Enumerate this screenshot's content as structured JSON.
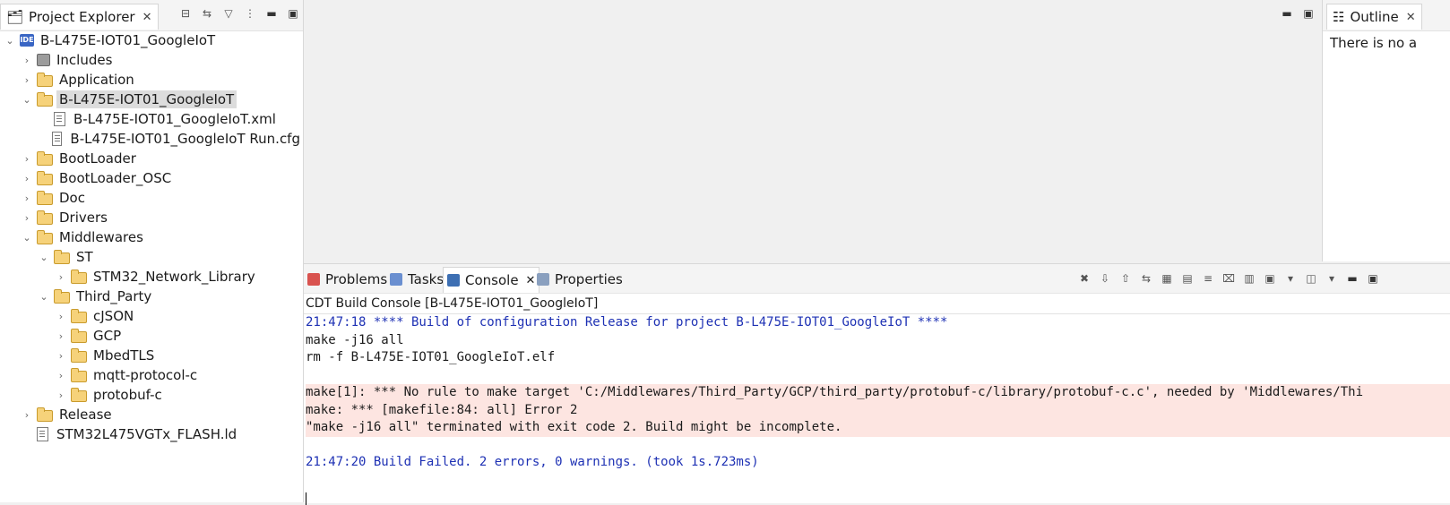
{
  "explorer": {
    "tab_label": "Project Explorer",
    "tree": [
      {
        "label": "B-L475E-IOT01_GoogleIoT",
        "level": 0,
        "icon": "project-icon",
        "expanded": true
      },
      {
        "label": "Includes",
        "level": 1,
        "icon": "includes-icon",
        "expanded": false
      },
      {
        "label": "Application",
        "level": 1,
        "icon": "folder-icon",
        "expanded": false
      },
      {
        "label": "B-L475E-IOT01_GoogleIoT",
        "level": 1,
        "icon": "folder-icon",
        "expanded": true,
        "selected": true
      },
      {
        "label": "B-L475E-IOT01_GoogleIoT.xml",
        "level": 2,
        "icon": "file-icon",
        "leaf": true
      },
      {
        "label": "B-L475E-IOT01_GoogleIoT Run.cfg",
        "level": 2,
        "icon": "file-icon",
        "leaf": true
      },
      {
        "label": "BootLoader",
        "level": 1,
        "icon": "folder-icon",
        "expanded": false
      },
      {
        "label": "BootLoader_OSC",
        "level": 1,
        "icon": "folder-icon",
        "expanded": false
      },
      {
        "label": "Doc",
        "level": 1,
        "icon": "folder-icon",
        "expanded": false
      },
      {
        "label": "Drivers",
        "level": 1,
        "icon": "folder-icon",
        "expanded": false
      },
      {
        "label": "Middlewares",
        "level": 1,
        "icon": "folder-icon",
        "expanded": true
      },
      {
        "label": "ST",
        "level": 2,
        "icon": "folder-icon",
        "expanded": true
      },
      {
        "label": "STM32_Network_Library",
        "level": 3,
        "icon": "folder-icon",
        "expanded": false
      },
      {
        "label": "Third_Party",
        "level": 2,
        "icon": "folder-icon",
        "expanded": true
      },
      {
        "label": "cJSON",
        "level": 3,
        "icon": "folder-icon",
        "expanded": false
      },
      {
        "label": "GCP",
        "level": 3,
        "icon": "folder-icon",
        "expanded": false
      },
      {
        "label": "MbedTLS",
        "level": 3,
        "icon": "folder-icon",
        "expanded": false
      },
      {
        "label": "mqtt-protocol-c",
        "level": 3,
        "icon": "folder-icon",
        "expanded": false
      },
      {
        "label": "protobuf-c",
        "level": 3,
        "icon": "folder-icon",
        "expanded": false
      },
      {
        "label": "Release",
        "level": 1,
        "icon": "folder-icon",
        "expanded": false
      },
      {
        "label": "STM32L475VGTx_FLASH.ld",
        "level": 1,
        "icon": "file-icon",
        "leaf": true
      }
    ]
  },
  "outline": {
    "tab_label": "Outline",
    "message": "There is no a"
  },
  "bottom": {
    "tabs": [
      {
        "label": "Problems",
        "icon": "problems-icon"
      },
      {
        "label": "Tasks",
        "icon": "tasks-icon"
      },
      {
        "label": "Console",
        "icon": "console-icon",
        "active": true
      },
      {
        "label": "Properties",
        "icon": "properties-icon"
      }
    ],
    "console_title": "CDT Build Console [B-L475E-IOT01_GoogleIoT]",
    "lines": [
      {
        "text": "21:47:18 **** Build of configuration Release for project B-L475E-IOT01_GoogleIoT ****",
        "style": "info"
      },
      {
        "text": "make -j16 all",
        "style": "normal"
      },
      {
        "text": "rm -f B-L475E-IOT01_GoogleIoT.elf",
        "style": "normal"
      },
      {
        "text": "",
        "style": "normal"
      },
      {
        "text": "make[1]: *** No rule to make target 'C:/Middlewares/Third_Party/GCP/third_party/protobuf-c/library/protobuf-c.c', needed by 'Middlewares/Thi",
        "style": "error"
      },
      {
        "text": "make: *** [makefile:84: all] Error 2",
        "style": "error"
      },
      {
        "text": "\"make -j16 all\" terminated with exit code 2. Build might be incomplete.",
        "style": "error"
      },
      {
        "text": "",
        "style": "normal"
      },
      {
        "text": "21:47:20 Build Failed. 2 errors, 0 warnings. (took 1s.723ms)",
        "style": "info"
      },
      {
        "text": "",
        "style": "normal"
      }
    ]
  },
  "colors": {
    "info_text": "#1e31b4",
    "error_bg": "#fde5e1",
    "folder": "#f6d27a"
  }
}
